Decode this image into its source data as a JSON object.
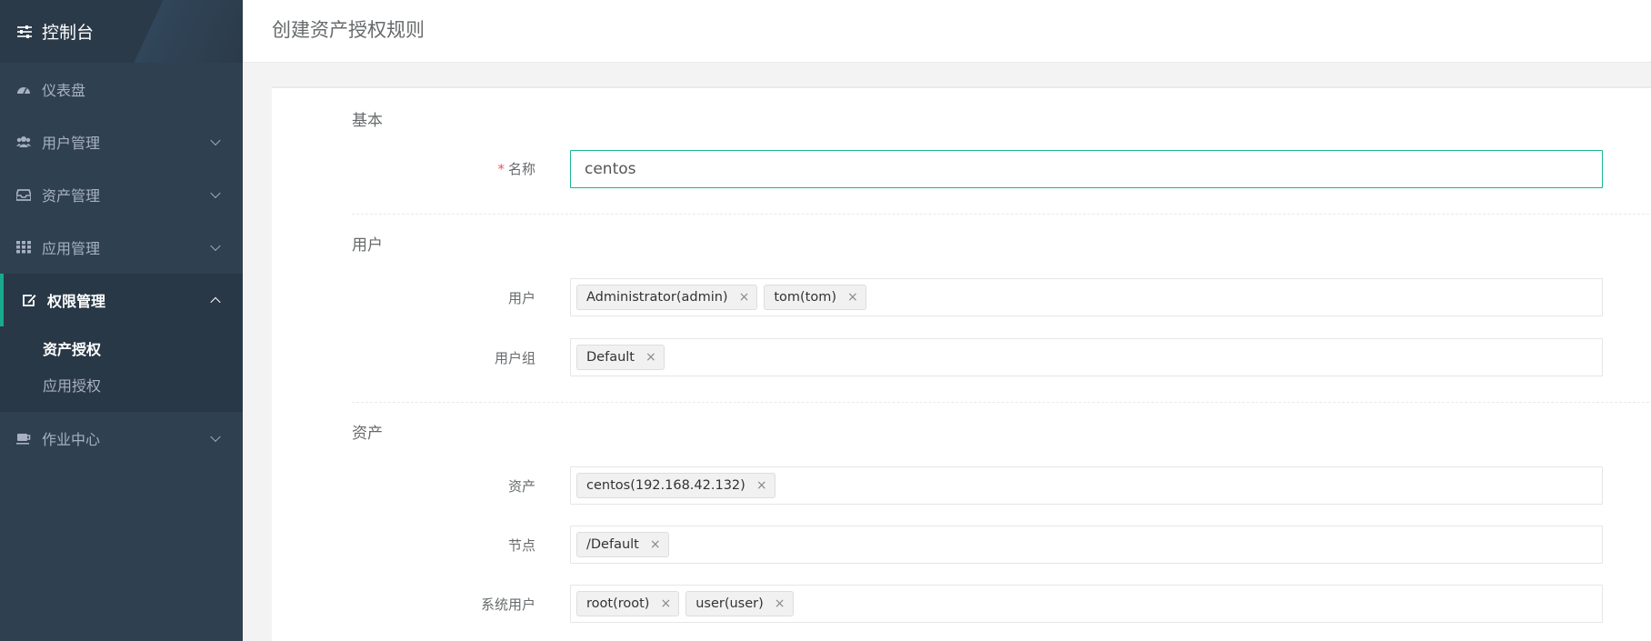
{
  "sidebar": {
    "brand": "控制台",
    "items": [
      {
        "label": "仪表盘",
        "icon": "dashboard-icon",
        "chevron": false
      },
      {
        "label": "用户管理",
        "icon": "users-icon",
        "chevron": true
      },
      {
        "label": "资产管理",
        "icon": "inbox-icon",
        "chevron": true
      },
      {
        "label": "应用管理",
        "icon": "grid-icon",
        "chevron": true
      },
      {
        "label": "权限管理",
        "icon": "edit-icon",
        "chevron": true,
        "active": true
      },
      {
        "label": "作业中心",
        "icon": "coffee-icon",
        "chevron": true
      }
    ],
    "subitems": [
      {
        "label": "资产授权",
        "active": true
      },
      {
        "label": "应用授权",
        "active": false
      }
    ]
  },
  "header": {
    "title": "创建资产授权规则"
  },
  "form": {
    "sections": {
      "basic": "基本",
      "user": "用户",
      "asset": "资产"
    },
    "name": {
      "label": "名称",
      "required": "*",
      "value": "centos"
    },
    "users": {
      "label": "用户",
      "tags": [
        "Administrator(admin)",
        "tom(tom)"
      ]
    },
    "user_groups": {
      "label": "用户组",
      "tags": [
        "Default"
      ]
    },
    "assets": {
      "label": "资产",
      "tags": [
        "centos(192.168.42.132)"
      ]
    },
    "nodes": {
      "label": "节点",
      "tags": [
        "/Default"
      ]
    },
    "system_users": {
      "label": "系统用户",
      "tags": [
        "root(root)",
        "user(user)"
      ]
    },
    "remove_symbol": "×"
  },
  "colors": {
    "sidebar_bg": "#2f4050",
    "accent": "#1ab394",
    "required": "#ed5565"
  }
}
